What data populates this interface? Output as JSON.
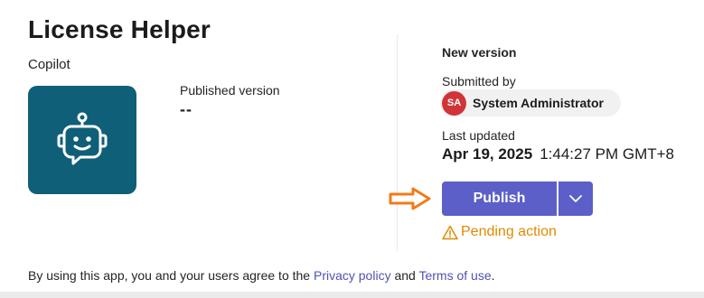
{
  "app": {
    "title": "License Helper",
    "subtitle": "Copilot",
    "icon": "bot-icon",
    "icon_bg": "#0f5f78"
  },
  "published": {
    "label": "Published version",
    "value": "--"
  },
  "new_version": {
    "heading": "New version",
    "submitted_label": "Submitted by",
    "submitter": {
      "initials": "SA",
      "name": "System Administrator",
      "avatar_color": "#d13438"
    },
    "updated_label": "Last updated",
    "updated_date": "Apr 19, 2025",
    "updated_time": "1:44:27 PM GMT+8"
  },
  "actions": {
    "publish_label": "Publish",
    "dropdown_icon": "chevron-down-icon",
    "accent": "#5b5fc7",
    "annotation_arrow_color": "#f07c1a"
  },
  "status": {
    "pending_text": "Pending action",
    "icon": "warning-icon",
    "color": "#e08b00"
  },
  "footer": {
    "prefix": "By using this app, you and your users agree to the ",
    "privacy_link": "Privacy policy",
    "and": " and ",
    "terms_link": "Terms of use",
    "suffix": "."
  }
}
